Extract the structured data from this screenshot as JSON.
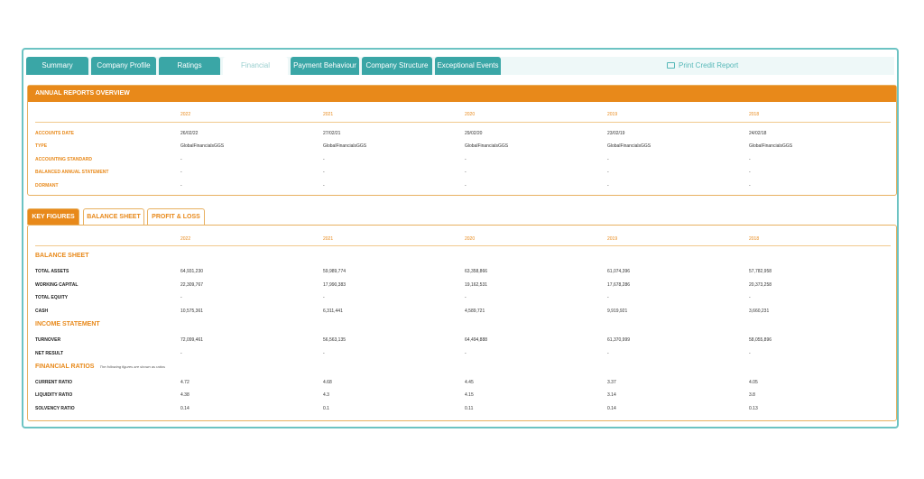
{
  "tabs": [
    {
      "label": "Summary",
      "active": false
    },
    {
      "label": "Company Profile",
      "active": false
    },
    {
      "label": "Ratings",
      "active": false
    },
    {
      "label": "Financial",
      "active": true
    },
    {
      "label": "Payment Behaviour",
      "active": false
    },
    {
      "label": "Company Structure",
      "active": false
    },
    {
      "label": "Exceptional Events",
      "active": false
    }
  ],
  "print_label": "Print Credit Report",
  "overview": {
    "title": "ANNUAL REPORTS OVERVIEW",
    "years": [
      "2022",
      "2021",
      "2020",
      "2019",
      "2018"
    ],
    "rows": [
      {
        "label": "ACCOUNTS DATE",
        "values": [
          "26/02/22",
          "27/02/21",
          "29/02/20",
          "23/02/19",
          "24/02/18"
        ]
      },
      {
        "label": "TYPE",
        "values": [
          "GlobalFinancialsGGS",
          "GlobalFinancialsGGS",
          "GlobalFinancialsGGS",
          "GlobalFinancialsGGS",
          "GlobalFinancialsGGS"
        ]
      },
      {
        "label": "ACCOUNTING STANDARD",
        "values": [
          "-",
          "-",
          "-",
          "-",
          "-"
        ]
      },
      {
        "label": "BALANCED ANNUAL STATEMENT",
        "values": [
          "-",
          "-",
          "-",
          "-",
          "-"
        ]
      },
      {
        "label": "DORMANT",
        "values": [
          "-",
          "-",
          "-",
          "-",
          "-"
        ]
      }
    ]
  },
  "subtabs": [
    {
      "label": "KEY FIGURES",
      "active": true
    },
    {
      "label": "BALANCE SHEET",
      "active": false
    },
    {
      "label": "PROFIT & LOSS",
      "active": false
    }
  ],
  "key_figures": {
    "years": [
      "2022",
      "2021",
      "2020",
      "2019",
      "2018"
    ],
    "balance_sheet": {
      "title": "BALANCE SHEET",
      "rows": [
        {
          "label": "TOTAL ASSETS",
          "values": [
            "64,931,230",
            "59,989,774",
            "63,358,866",
            "61,074,396",
            "57,782,958"
          ]
        },
        {
          "label": "WORKING CAPITAL",
          "values": [
            "22,309,767",
            "17,990,383",
            "19,162,531",
            "17,678,286",
            "20,373,258"
          ]
        },
        {
          "label": "TOTAL EQUITY",
          "values": [
            "-",
            "-",
            "-",
            "-",
            "-"
          ]
        },
        {
          "label": "CASH",
          "values": [
            "10,575,361",
            "6,311,441",
            "4,589,721",
            "9,919,921",
            "3,660,231"
          ]
        }
      ]
    },
    "income_statement": {
      "title": "INCOME STATEMENT",
      "rows": [
        {
          "label": "TURNOVER",
          "values": [
            "72,099,461",
            "56,563,135",
            "64,494,888",
            "61,370,999",
            "58,055,896"
          ]
        },
        {
          "label": "NET RESULT",
          "values": [
            "-",
            "-",
            "-",
            "-",
            "-"
          ]
        }
      ]
    },
    "financial_ratios": {
      "title": "FINANCIAL RATIOS",
      "note": "The following figures are shown as ratios",
      "rows": [
        {
          "label": "CURRENT RATIO",
          "values": [
            "4.72",
            "4.68",
            "4.45",
            "3.37",
            "4.05"
          ]
        },
        {
          "label": "LIQUIDITY RATIO",
          "values": [
            "4.38",
            "4.3",
            "4.15",
            "3.14",
            "3.8"
          ]
        },
        {
          "label": "SOLVENCY RATIO",
          "values": [
            "0.14",
            "0.1",
            "0.11",
            "0.14",
            "0.13"
          ]
        }
      ]
    }
  }
}
